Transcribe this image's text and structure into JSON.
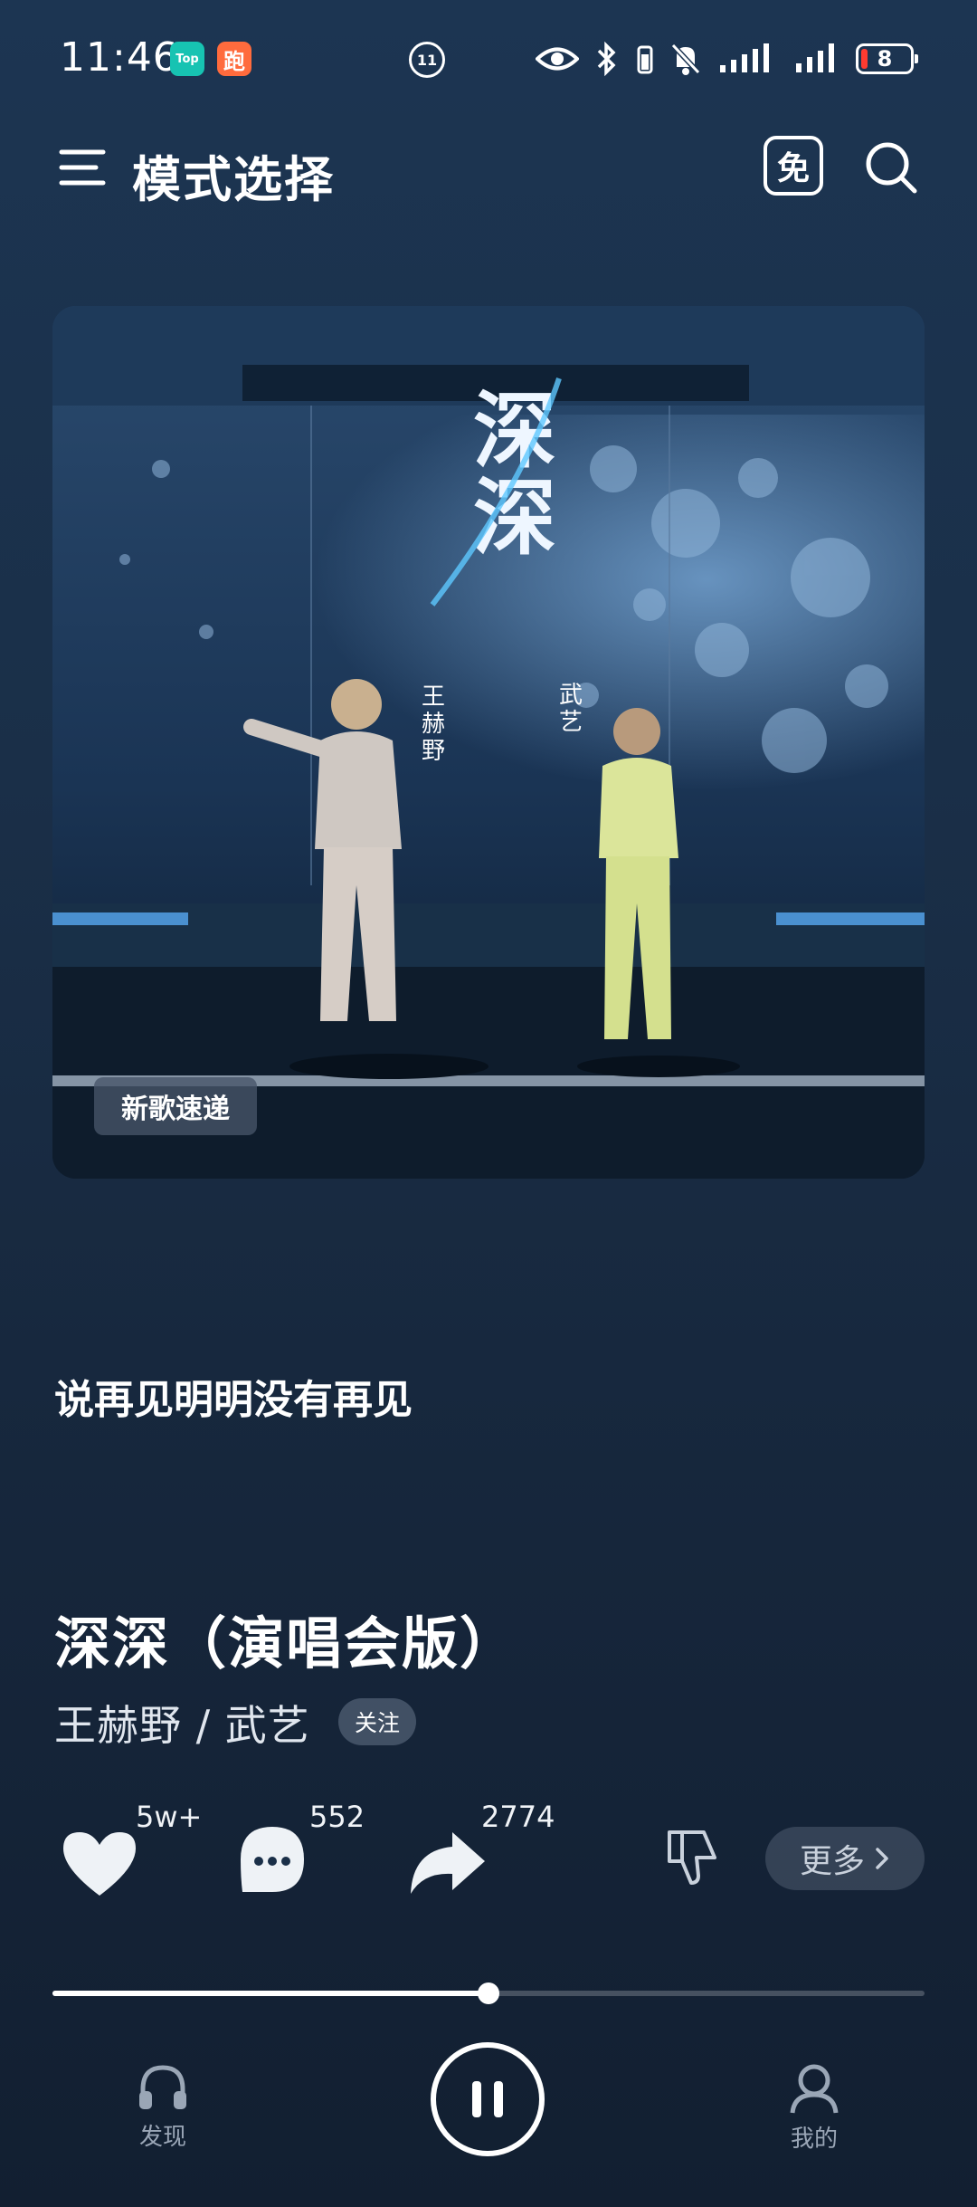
{
  "status_bar": {
    "time": "11:46",
    "app_badges": [
      "Top",
      "跑"
    ],
    "center_icon": "11",
    "battery_level": "8"
  },
  "header": {
    "title": "模式选择",
    "free_label": "免"
  },
  "cover": {
    "art_title": "深深",
    "artist_left": "王赫野",
    "artist_right": "武艺",
    "tag": "新歌速递"
  },
  "lyric_line": "说再见明明没有再见",
  "song": {
    "title": "深深（演唱会版）",
    "artists": "王赫野 / 武艺",
    "follow_label": "关注"
  },
  "actions": {
    "like_count": "5w+",
    "comment_count": "552",
    "share_count": "2774",
    "more_label": "更多"
  },
  "progress": {
    "buffered": 0.25,
    "played": 0.5
  },
  "bottom_nav": {
    "discover_label": "发现",
    "mine_label": "我的"
  },
  "colors": {
    "background_top": "#1c3552",
    "background_bottom": "#121f31",
    "accent": "#ffffff",
    "muted_text": "#9aa6b6"
  },
  "icons": [
    "menu-icon",
    "free-mode-icon",
    "search-icon",
    "heart-icon",
    "comment-icon",
    "share-icon",
    "dislike-icon",
    "chevron-right-icon",
    "pause-icon",
    "headphones-icon",
    "user-icon",
    "eye-icon",
    "bluetooth-icon",
    "mute-icon",
    "signal-icon",
    "battery-icon"
  ]
}
